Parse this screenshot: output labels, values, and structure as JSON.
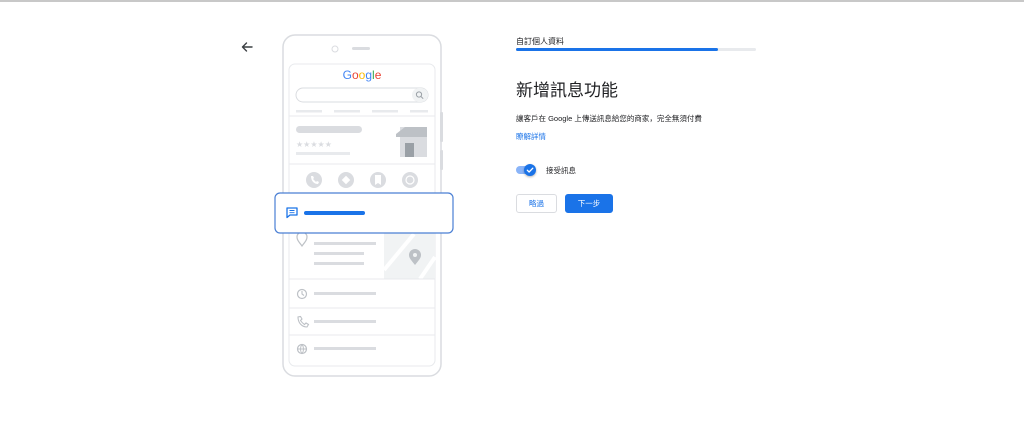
{
  "header": {
    "step_label": "自訂個人資料",
    "progress_fraction": 0.84
  },
  "main": {
    "title": "新增訊息功能",
    "description": "讓客戶在 Google 上傳送訊息給您的商家，完全無須付費",
    "learn_more": "瞭解詳情",
    "toggle": {
      "label": "接受訊息",
      "checked": true
    }
  },
  "actions": {
    "skip_label": "略過",
    "next_label": "下一步"
  },
  "illustration": {
    "search_logo": "Google"
  },
  "colors": {
    "accent": "#1a73e8",
    "accent_light": "#8ab4f8",
    "text": "#202124",
    "placeholder_gray": "#dadce0",
    "icon_gray": "#bdc1c6"
  },
  "icons": [
    "arrow-back-icon",
    "search-icon",
    "phone-icon",
    "directions-icon",
    "bookmark-icon",
    "globe-icon",
    "chat-icon",
    "location-pin-icon",
    "clock-icon",
    "check-icon"
  ]
}
